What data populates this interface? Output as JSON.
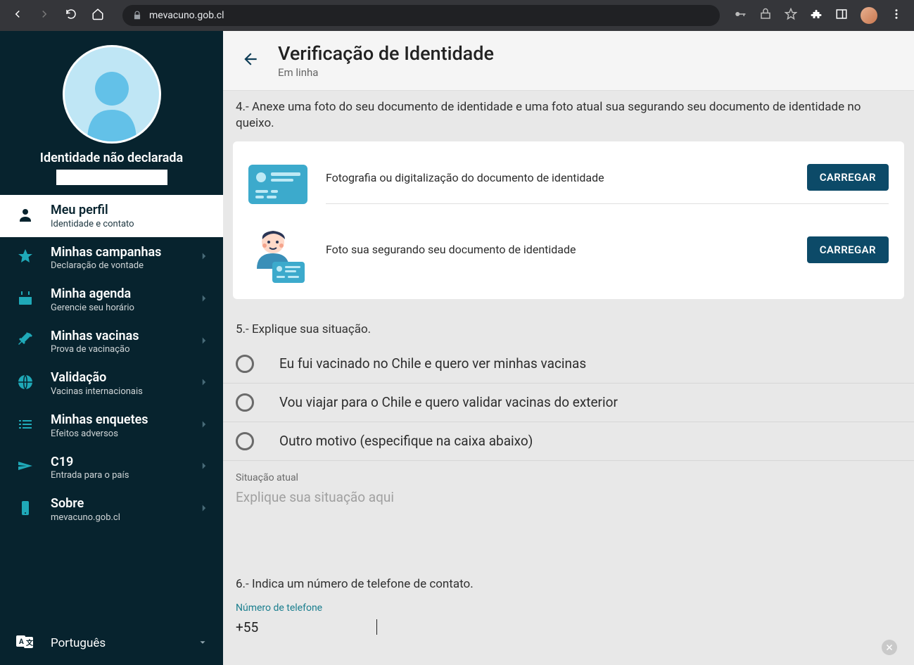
{
  "browser": {
    "url": "mevacuno.gob.cl"
  },
  "sidebar": {
    "identity_label": "Identidade não declarada",
    "items": [
      {
        "title": "Meu perfil",
        "subtitle": "Identidade e contato"
      },
      {
        "title": "Minhas campanhas",
        "subtitle": "Declaração de vontade"
      },
      {
        "title": "Minha agenda",
        "subtitle": "Gerencie seu horário"
      },
      {
        "title": "Minhas vacinas",
        "subtitle": "Prova de vacinação"
      },
      {
        "title": "Validação",
        "subtitle": "Vacinas internacionais"
      },
      {
        "title": "Minhas enquetes",
        "subtitle": "Efeitos adversos"
      },
      {
        "title": "C19",
        "subtitle": "Entrada para o país"
      },
      {
        "title": "Sobre",
        "subtitle": "mevacuno.gob.cl"
      }
    ],
    "language": "Português"
  },
  "header": {
    "title": "Verificação de Identidade",
    "subtitle": "Em linha"
  },
  "section4": {
    "text": "4.- Anexe uma foto do seu documento de identidade e uma foto atual sua segurando seu documento de identidade no queixo.",
    "row1_label": "Fotografia ou digitalização do documento de identidade",
    "row2_label": "Foto sua segurando seu documento de identidade",
    "upload_button": "CARREGAR"
  },
  "section5": {
    "text": "5.- Explique sua situação.",
    "options": [
      "Eu fui vacinado no Chile e quero ver minhas vacinas",
      "Vou viajar para o Chile e quero validar vacinas do exterior",
      "Outro motivo (especifique na caixa abaixo)"
    ],
    "field_label": "Situação atual",
    "placeholder": "Explique sua situação aqui"
  },
  "section6": {
    "text": "6.- Indica um número de telefone de contato.",
    "field_label": "Número de telefone",
    "value": "+55"
  }
}
